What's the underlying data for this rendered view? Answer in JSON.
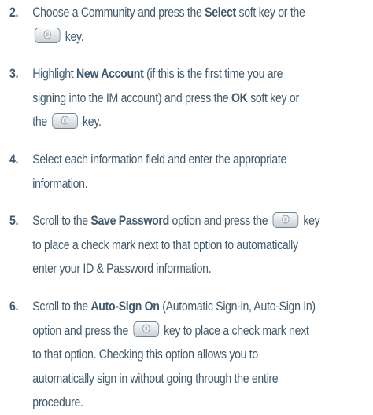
{
  "steps": [
    {
      "number": "2.",
      "lines": [
        [
          {
            "t": "Choose a Community and press the "
          },
          {
            "t": "Select",
            "b": true
          },
          {
            "t": " soft key or the"
          }
        ],
        [
          {
            "key": true
          },
          {
            "t": " key."
          }
        ]
      ]
    },
    {
      "number": "3.",
      "lines": [
        [
          {
            "t": "Highlight "
          },
          {
            "t": "New Account",
            "b": true
          },
          {
            "t": " (if this is the first time you are"
          }
        ],
        [
          {
            "t": "signing into the IM account) and press the "
          },
          {
            "t": "OK",
            "b": true
          },
          {
            "t": " soft key or"
          }
        ],
        [
          {
            "t": "the "
          },
          {
            "key": true
          },
          {
            "t": " key."
          }
        ]
      ]
    },
    {
      "number": "4.",
      "lines": [
        [
          {
            "t": "Select each information field and enter the appropriate"
          }
        ],
        [
          {
            "t": "information."
          }
        ]
      ]
    },
    {
      "number": "5.",
      "lines": [
        [
          {
            "t": "Scroll to the "
          },
          {
            "t": "Save Password",
            "b": true
          },
          {
            "t": " option and press the "
          },
          {
            "key": true
          },
          {
            "t": " key"
          }
        ],
        [
          {
            "t": "to place a check mark next to that option to automatically"
          }
        ],
        [
          {
            "t": "enter your ID & Password information."
          }
        ]
      ]
    },
    {
      "number": "6.",
      "lines": [
        [
          {
            "t": "Scroll to the "
          },
          {
            "t": "Auto-Sign On",
            "b": true
          },
          {
            "t": " (Automatic Sign-in, Auto-Sign In)"
          }
        ],
        [
          {
            "t": "option and press the "
          },
          {
            "key": true
          },
          {
            "t": " key to place a check mark next"
          }
        ],
        [
          {
            "t": "to that option. Checking this option allows you to"
          }
        ],
        [
          {
            "t": "automatically sign in without going through the entire"
          }
        ],
        [
          {
            "t": "procedure."
          }
        ]
      ]
    }
  ],
  "icons": {
    "center_key": "center-select-key-icon"
  },
  "colors": {
    "text": "#3f5a6e",
    "key_border": "#6f8493"
  }
}
